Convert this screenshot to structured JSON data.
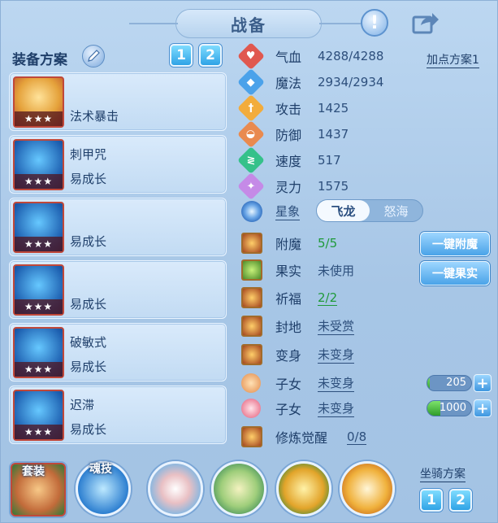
{
  "header": {
    "title": "战备"
  },
  "plan": {
    "label": "装备方案",
    "buttons": [
      "1",
      "2"
    ]
  },
  "equipment": [
    {
      "name": "",
      "effect": "法术暴击",
      "stars": "★★★"
    },
    {
      "name": "刺甲咒",
      "effect": "易成长",
      "stars": "★★★"
    },
    {
      "name": "",
      "effect": "易成长",
      "stars": "★★★"
    },
    {
      "name": "",
      "effect": "易成长",
      "stars": "★★★"
    },
    {
      "name": "破敏式",
      "effect": "易成长",
      "stars": "★★★"
    },
    {
      "name": "迟滞",
      "effect": "易成长",
      "stars": "★★★"
    }
  ],
  "stats": {
    "addpoint_label": "加点方案1",
    "items": [
      {
        "name": "气血",
        "value": "4288/4288",
        "icon": "heart-icon",
        "color": "#e0584f"
      },
      {
        "name": "魔法",
        "value": "2934/2934",
        "icon": "mana-icon",
        "color": "#4ba2ea"
      },
      {
        "name": "攻击",
        "value": "1425",
        "icon": "sword-icon",
        "color": "#f2ac3c"
      },
      {
        "name": "防御",
        "value": "1437",
        "icon": "shield-icon",
        "color": "#e98a4f"
      },
      {
        "name": "速度",
        "value": "517",
        "icon": "speed-icon",
        "color": "#35c18a"
      },
      {
        "name": "灵力",
        "value": "1575",
        "icon": "spirit-icon",
        "color": "#c58ae7"
      }
    ],
    "xingxiang": {
      "name": "星象",
      "options": [
        "飞龙",
        "怒海"
      ],
      "selected": "飞龙"
    }
  },
  "features": {
    "fumo": {
      "name": "附魔",
      "value": "5/5",
      "button": "一键附魔"
    },
    "guoshi": {
      "name": "果实",
      "value": "未使用",
      "button": "一键果实"
    },
    "qifu": {
      "name": "祈福",
      "value": "2/2"
    },
    "fengdi": {
      "name": "封地",
      "value": "未受赏"
    },
    "bianshen": {
      "name": "变身",
      "value": "未变身"
    },
    "zinv1": {
      "name": "子女",
      "value": "未变身",
      "meter": "205",
      "meter_fraction": 0.05
    },
    "zinv2": {
      "name": "子女",
      "value": "未变身",
      "meter": "1000",
      "meter_fraction": 0.3
    },
    "xiulian": {
      "name": "修炼觉醒",
      "value": "0/8"
    }
  },
  "bottom": {
    "suit_label": "套装",
    "soul_label": "魂技",
    "mount": {
      "label": "坐骑方案",
      "buttons": [
        "1",
        "2"
      ]
    }
  }
}
